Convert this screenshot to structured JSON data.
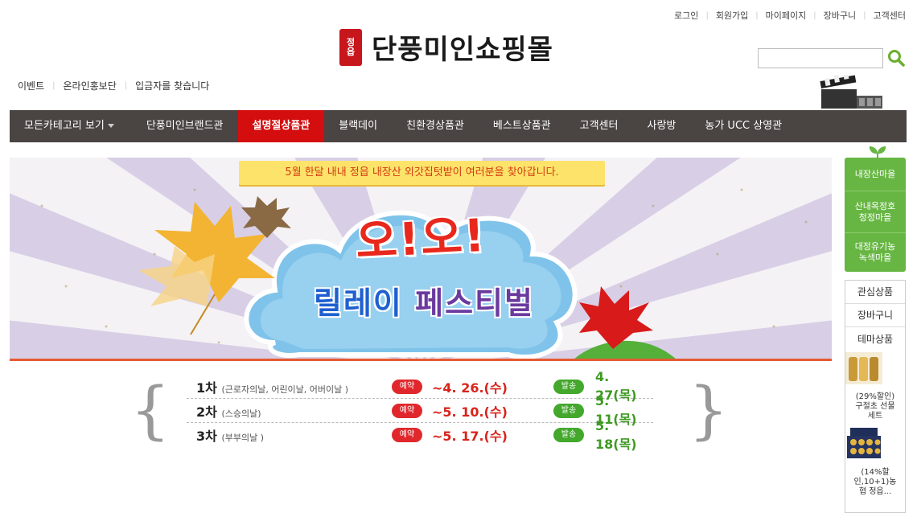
{
  "top_links": [
    "로그인",
    "회원가입",
    "마이페이지",
    "장바구니",
    "고객센터"
  ],
  "logo": {
    "seal": [
      "정",
      "읍"
    ],
    "text": "단풍미인쇼핑몰"
  },
  "search": {
    "value": "",
    "placeholder": ""
  },
  "sub_links": [
    "이벤트",
    "온라인홍보단",
    "입금자를 찾습니다"
  ],
  "nav": {
    "items": [
      {
        "label": "모든카테고리 보기"
      },
      {
        "label": "단풍미인브랜드관"
      },
      {
        "label": "설명절상품관"
      },
      {
        "label": "블랙데이"
      },
      {
        "label": "친환경상품관"
      },
      {
        "label": "베스트상품관"
      },
      {
        "label": "고객센터"
      },
      {
        "label": "사랑방"
      },
      {
        "label": "농가 UCC 상영관"
      }
    ]
  },
  "banner": {
    "ribbon": "5월 한달 내내 정읍 내장산 외갓집텃밭이 여러분을 찾아갑니다.",
    "headline": "오!오!",
    "relay_blue": "릴레이",
    "relay_purple": " 페스티벌"
  },
  "schedule": [
    {
      "round": "1차",
      "note": "(근로자의날, 어린이날, 어버이날 )",
      "reserve_badge": "예약",
      "reserve_date": "~4. 26.(수)",
      "ship_badge": "발송",
      "ship_date": "4. 27(목)"
    },
    {
      "round": "2차",
      "note": "(스승의날)",
      "reserve_badge": "예약",
      "reserve_date": "~5. 10.(수)",
      "ship_badge": "발송",
      "ship_date": "5. 11(목)"
    },
    {
      "round": "3차",
      "note": "(부부의날 )",
      "reserve_badge": "예약",
      "reserve_date": "~5. 17.(수)",
      "ship_badge": "발송",
      "ship_date": "5. 18(목)"
    }
  ],
  "villages": [
    "내장산마을",
    "산내옥정호\n청정마을",
    "대정유기농\n녹색마을"
  ],
  "side": {
    "interest": "관심상품",
    "cart": "장바구니",
    "theme": "테마상품",
    "products": [
      {
        "caption": "(29%할인)\n구절초 선물\n세트"
      },
      {
        "caption": "(14%할\n인,10+1)농\n협 정읍..."
      }
    ]
  },
  "colors": {
    "nav_bg": "#4a4443",
    "nav_active": "#d40d0f",
    "village_green": "#67b643",
    "reserve_red": "#e0282c",
    "ship_green": "#43a82c"
  }
}
